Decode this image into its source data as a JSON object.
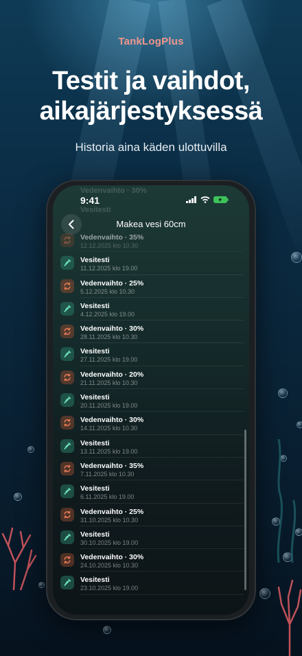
{
  "app_name": "TankLogPlus",
  "headline": [
    "Testit ja vaihdot,",
    "aikajärjestyksessä"
  ],
  "subheadline": "Historia aina käden ulottuvilla",
  "phone": {
    "time": "9:41",
    "nav_title": "Makea vesi 60cm",
    "ghost_rows": [
      "Vedenvaihto · 30%",
      "Vesitesti"
    ],
    "colors": {
      "change_icon": "#e07a55",
      "test_icon": "#6fe0b8"
    },
    "entries": [
      {
        "type": "change",
        "icon": "refresh-icon",
        "title": "Vedenvaihto · 35%",
        "date": "12.12.2025 klo 10.30",
        "faded": true
      },
      {
        "type": "test",
        "icon": "pipette-icon",
        "title": "Vesitesti",
        "date": "11.12.2025 klo 19.00"
      },
      {
        "type": "change",
        "icon": "refresh-icon",
        "title": "Vedenvaihto · 25%",
        "date": "5.12.2025 klo 10.30"
      },
      {
        "type": "test",
        "icon": "pipette-icon",
        "title": "Vesitesti",
        "date": "4.12.2025 klo 19.00"
      },
      {
        "type": "change",
        "icon": "refresh-icon",
        "title": "Vedenvaihto · 30%",
        "date": "28.11.2025 klo 10.30"
      },
      {
        "type": "test",
        "icon": "pipette-icon",
        "title": "Vesitesti",
        "date": "27.11.2025 klo 19.00"
      },
      {
        "type": "change",
        "icon": "refresh-icon",
        "title": "Vedenvaihto · 20%",
        "date": "21.11.2025 klo 10.30"
      },
      {
        "type": "test",
        "icon": "pipette-icon",
        "title": "Vesitesti",
        "date": "20.11.2025 klo 19.00"
      },
      {
        "type": "change",
        "icon": "refresh-icon",
        "title": "Vedenvaihto · 30%",
        "date": "14.11.2025 klo 10.30"
      },
      {
        "type": "test",
        "icon": "pipette-icon",
        "title": "Vesitesti",
        "date": "13.11.2025 klo 19.00"
      },
      {
        "type": "change",
        "icon": "refresh-icon",
        "title": "Vedenvaihto · 35%",
        "date": "7.11.2025 klo 10.30"
      },
      {
        "type": "test",
        "icon": "pipette-icon",
        "title": "Vesitesti",
        "date": "6.11.2025 klo 19.00"
      },
      {
        "type": "change",
        "icon": "refresh-icon",
        "title": "Vedenvaihto · 25%",
        "date": "31.10.2025 klo 10.30"
      },
      {
        "type": "test",
        "icon": "pipette-icon",
        "title": "Vesitesti",
        "date": "30.10.2025 klo 19.00"
      },
      {
        "type": "change",
        "icon": "refresh-icon",
        "title": "Vedenvaihto · 30%",
        "date": "24.10.2025 klo 10.30"
      },
      {
        "type": "test",
        "icon": "pipette-icon",
        "title": "Vesitesti",
        "date": "23.10.2025 klo 19.00"
      }
    ]
  }
}
